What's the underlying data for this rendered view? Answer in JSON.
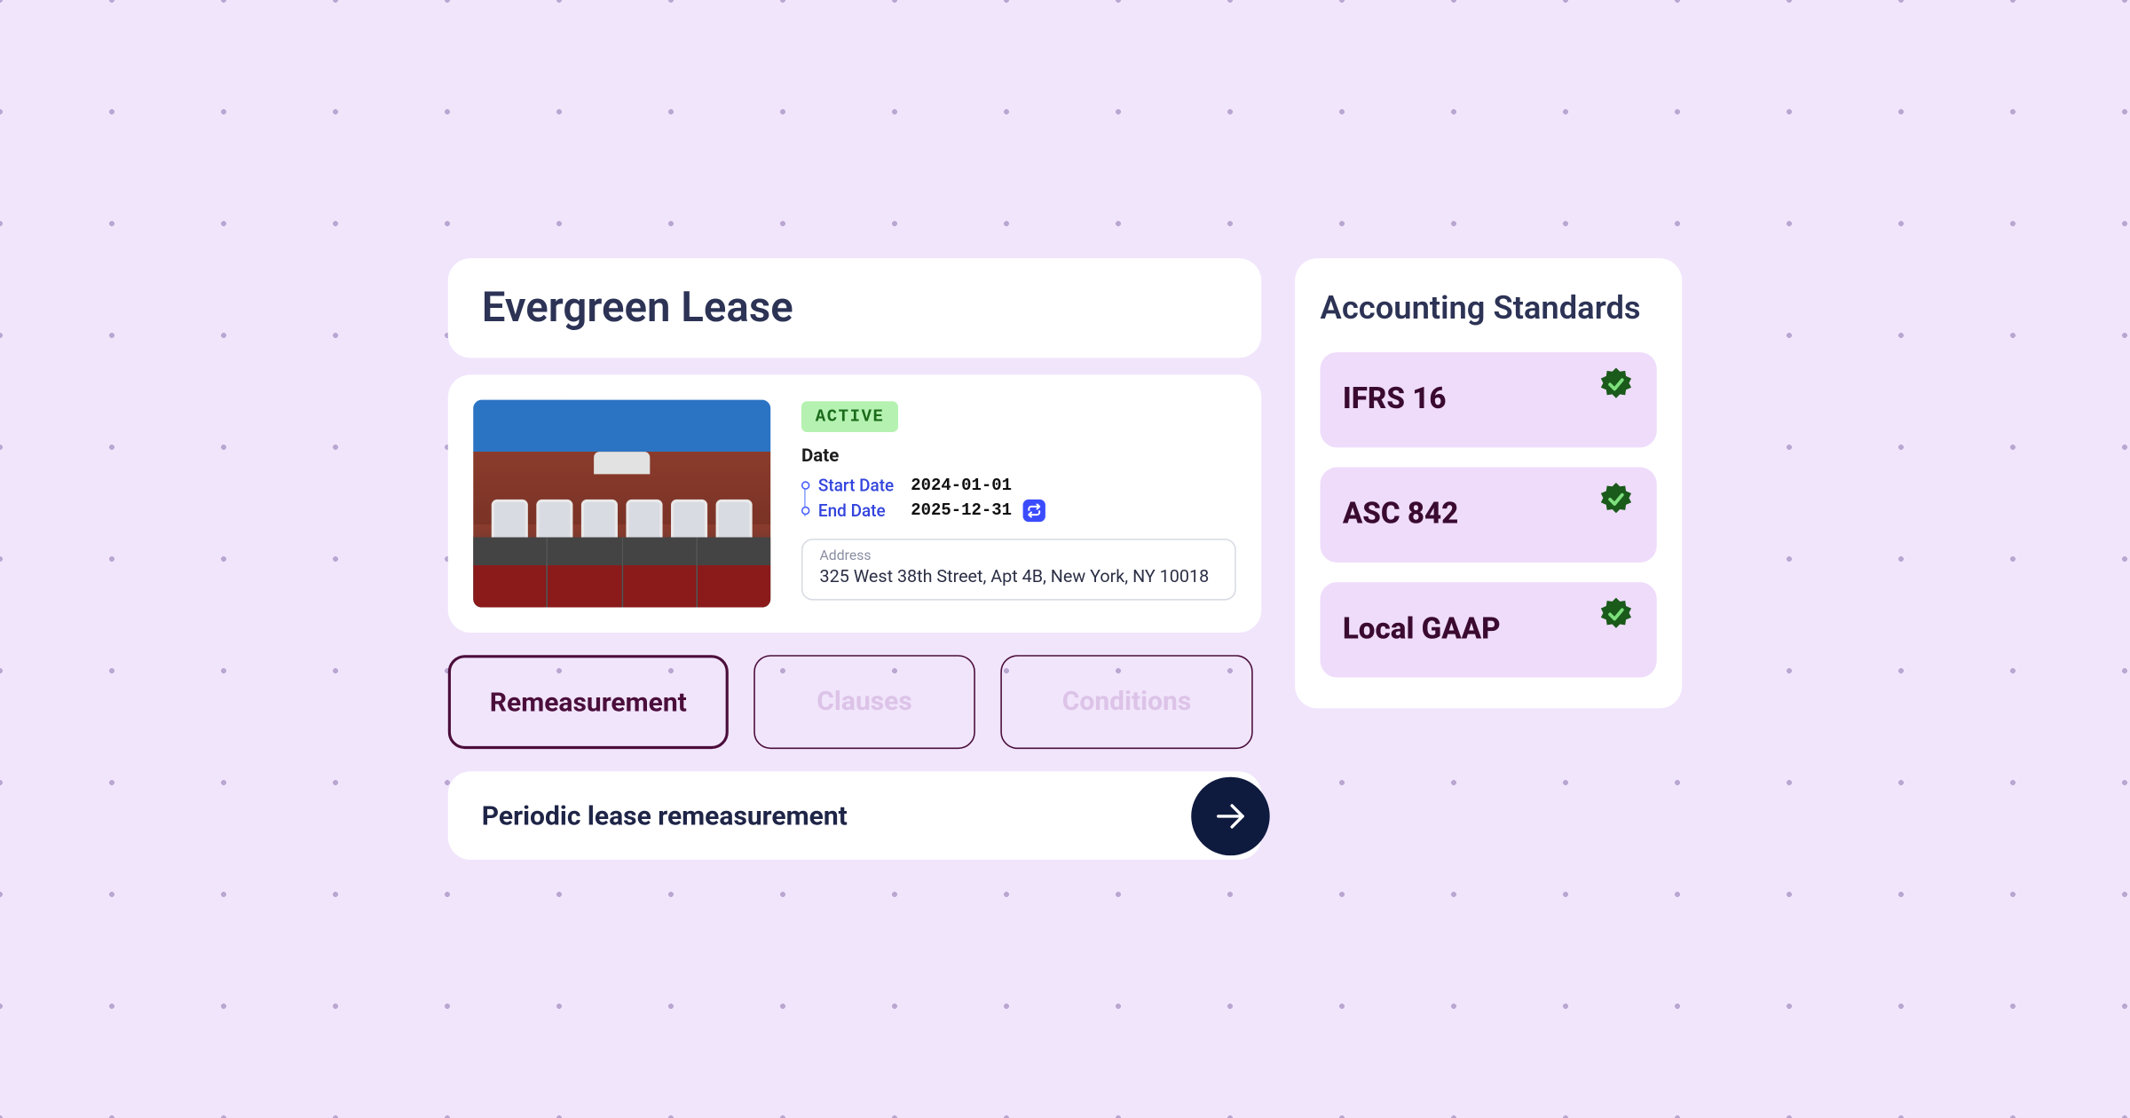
{
  "colors": {
    "page_bg": "#f1e5fc",
    "dot": "#b9a6d1",
    "card_bg": "#ffffff",
    "heading": "#2c3355",
    "tab_active_border": "#4b0e3b",
    "tab_inactive_text": "#dcc3e7",
    "std_item_bg": "#efdcfb",
    "std_item_text": "#3a0a30",
    "arrow_btn_bg": "#0f1a3f",
    "badge_bg": "#b5f2b1",
    "badge_text": "#1b6b1b",
    "link_blue": "#3344dd",
    "verify_green": "#1a5a1a"
  },
  "header": {
    "title": "Evergreen Lease"
  },
  "lease": {
    "status": "ACTIVE",
    "date_section_label": "Date",
    "start_date_label": "Start Date",
    "start_date_value": "2024-01-01",
    "end_date_label": "End Date",
    "end_date_value": "2025-12-31",
    "repeat_icon_name": "repeat-icon",
    "address_label": "Address",
    "address_value": "325 West 38th Street, Apt 4B, New York, NY 10018"
  },
  "tabs": [
    {
      "label": "Remeasurement",
      "active": true
    },
    {
      "label": "Clauses",
      "active": false
    },
    {
      "label": "Conditions",
      "active": false
    }
  ],
  "action": {
    "label": "Periodic lease remeasurement"
  },
  "standards": {
    "heading": "Accounting Standards",
    "items": [
      {
        "name": "IFRS 16",
        "verified": true
      },
      {
        "name": "ASC 842",
        "verified": true
      },
      {
        "name": "Local GAAP",
        "verified": true
      }
    ]
  }
}
